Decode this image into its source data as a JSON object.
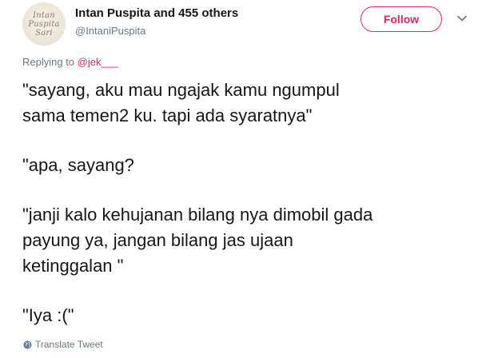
{
  "header": {
    "display_name": "Intan Puspita and 455 others",
    "handle": "@IntaniPuspita",
    "avatar_text": [
      "Intan",
      "Puspita",
      "Sari"
    ],
    "follow_label": "Follow",
    "chevron_icon": "chevron-down-icon"
  },
  "reply": {
    "prefix": "Replying to ",
    "mention": "@jek___"
  },
  "tweet": {
    "paragraphs": [
      "\"sayang, aku mau ngajak kamu ngumpul\nsama temen2 ku. tapi ada syaratnya\"",
      "\"apa, sayang?",
      "\"janji kalo kehujanan bilang nya dimobil gada\npayung ya, jangan bilang jas ujaan\nketinggalan \"",
      "\"Iya :(\""
    ]
  },
  "footer": {
    "translate_label": "Translate Tweet",
    "globe_icon": "globe-icon"
  },
  "colors": {
    "accent": "#e0245e",
    "text": "#14171a",
    "muted": "#657786"
  }
}
